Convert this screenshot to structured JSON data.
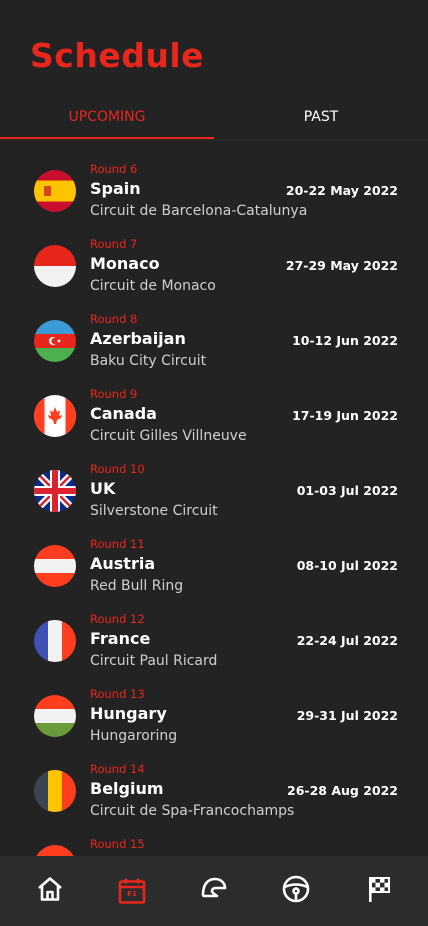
{
  "header": {
    "title": "Schedule"
  },
  "tabs": [
    {
      "label": "UPCOMING",
      "active": true
    },
    {
      "label": "PAST",
      "active": false
    }
  ],
  "races": [
    {
      "round": "Round 6",
      "country": "Spain",
      "circuit": "Circuit de Barcelona-Catalunya",
      "date": "20-22 May 2022"
    },
    {
      "round": "Round 7",
      "country": "Monaco",
      "circuit": "Circuit de Monaco",
      "date": "27-29 May 2022"
    },
    {
      "round": "Round 8",
      "country": "Azerbaijan",
      "circuit": "Baku City Circuit",
      "date": "10-12 Jun 2022"
    },
    {
      "round": "Round 9",
      "country": "Canada",
      "circuit": "Circuit Gilles Villneuve",
      "date": "17-19 Jun 2022"
    },
    {
      "round": "Round 10",
      "country": "UK",
      "circuit": "Silverstone Circuit",
      "date": "01-03 Jul 2022"
    },
    {
      "round": "Round 11",
      "country": "Austria",
      "circuit": "Red Bull Ring",
      "date": "08-10 Jul 2022"
    },
    {
      "round": "Round 12",
      "country": "France",
      "circuit": "Circuit Paul Ricard",
      "date": "22-24 Jul 2022"
    },
    {
      "round": "Round 13",
      "country": "Hungary",
      "circuit": "Hungaroring",
      "date": "29-31 Jul 2022"
    },
    {
      "round": "Round 14",
      "country": "Belgium",
      "circuit": "Circuit de Spa-Francochamps",
      "date": "26-28 Aug 2022"
    },
    {
      "round": "Round 15",
      "country": "",
      "circuit": "",
      "date": ""
    }
  ],
  "nav": {
    "items": [
      {
        "icon": "home-icon",
        "active": false
      },
      {
        "icon": "calendar-icon",
        "active": true,
        "badge": "F1"
      },
      {
        "icon": "track-icon",
        "active": false
      },
      {
        "icon": "steering-wheel-icon",
        "active": false
      },
      {
        "icon": "checkered-flag-icon",
        "active": false
      }
    ]
  },
  "colors": {
    "accent": "#e8261c",
    "background": "#232323",
    "nav_background": "#2c2c2c"
  }
}
